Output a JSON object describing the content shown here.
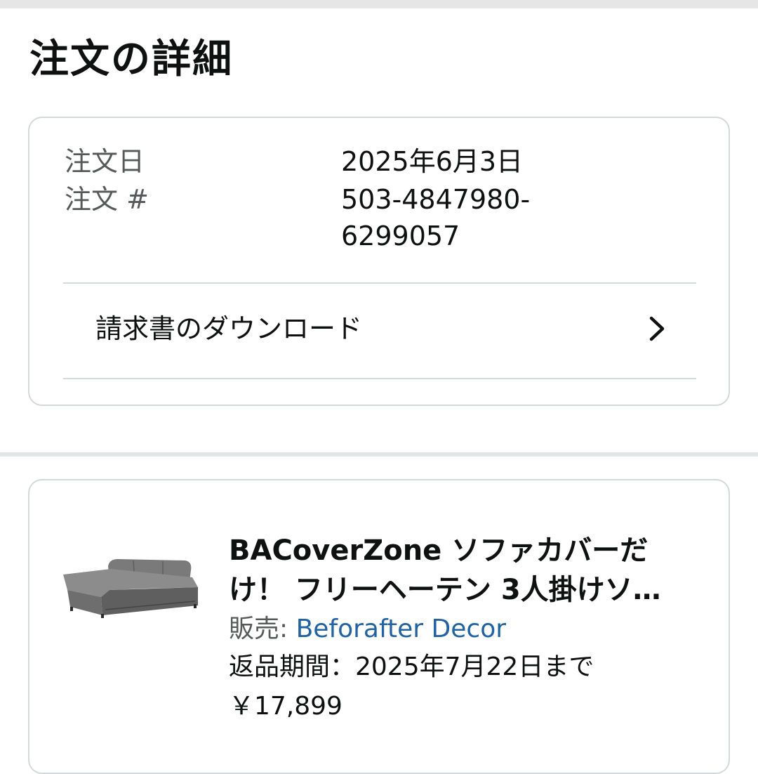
{
  "page": {
    "title": "注文の詳細"
  },
  "order": {
    "date_label": "注文日",
    "date_value": "2025年6月3日",
    "number_label": "注文 #",
    "number_line1": "503-4847980-",
    "number_line2": "6299057",
    "invoice_label": "請求書のダウンロード",
    "invoice_icon": "chevron-right-icon"
  },
  "item": {
    "title_line1": "BACoverZone ソファカバーだ",
    "title_line2": "け！ フリーヘーテン 3人掛けソ…",
    "seller_prefix": "販売: ",
    "seller_name": "Beforafter Decor",
    "return_text": "返品期間：2025年7月22日まで",
    "price": "￥17,899",
    "image": "sofa-thumbnail"
  },
  "colors": {
    "link": "#2162a1",
    "secondary_text": "#565959",
    "border": "#d5d9d9"
  }
}
